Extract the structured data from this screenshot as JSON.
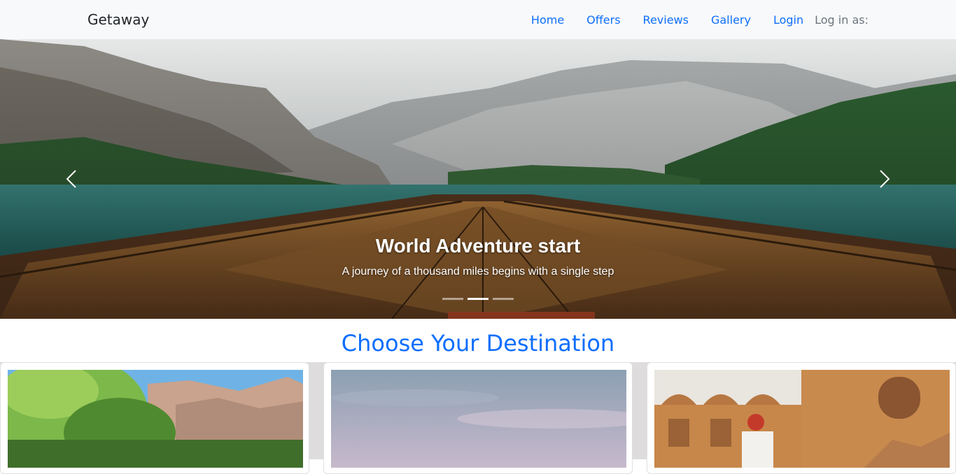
{
  "navbar": {
    "brand": "Getaway",
    "links": [
      "Home",
      "Offers",
      "Reviews",
      "Gallery",
      "Login"
    ],
    "login_status": "Log in as:"
  },
  "hero": {
    "title": "World Adventure start",
    "subtitle": "A journey of a thousand miles begins with a single step",
    "slides_count": 3,
    "active_slide": 2,
    "controls": [
      "chevron-left-icon",
      "chevron-right-icon"
    ]
  },
  "destinations": {
    "heading": "Choose Your Destination",
    "cards": [
      {
        "image": "forest-mountain-image"
      },
      {
        "image": "cloudy-sky-image"
      },
      {
        "image": "desert-fort-image"
      }
    ]
  },
  "colors": {
    "accent": "#0d6efd",
    "navbar_bg": "#f8f9fa",
    "muted": "#6c757d"
  }
}
